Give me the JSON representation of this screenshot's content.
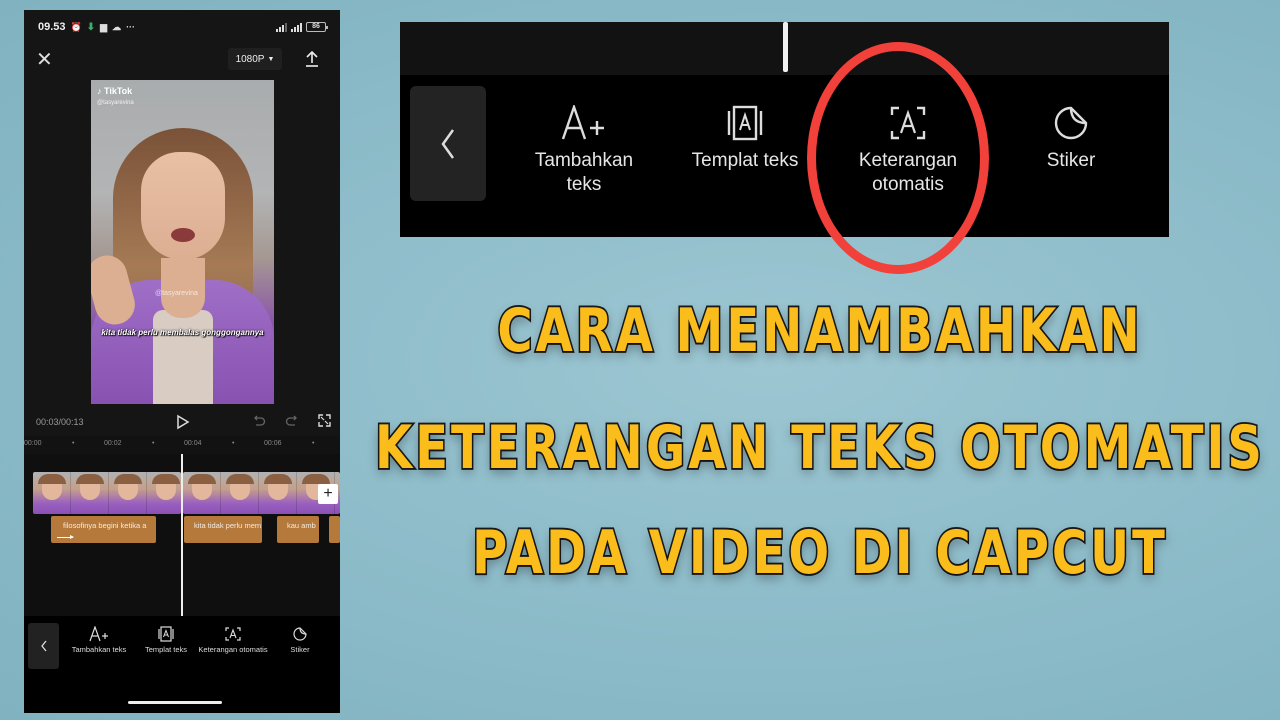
{
  "status_bar": {
    "time": "09.53",
    "battery": "86",
    "more": "···"
  },
  "top_bar": {
    "resolution": "1080P",
    "close_icon": "close-icon",
    "export_icon": "upload-icon"
  },
  "preview": {
    "watermark_brand": "TikTok",
    "watermark_handle": "@tasyarevina",
    "center_watermark": "@tasyarevina",
    "caption": "kita tidak perlu membalas gonggongannya"
  },
  "playback": {
    "timecode": "00:03/00:13",
    "ruler": [
      "00:00",
      "00:02",
      "00:04",
      "00:06"
    ]
  },
  "timeline": {
    "text_clips": [
      "filosofinya begini ketika a",
      "kita tidak perlu mem",
      "kau amb",
      ""
    ],
    "add_label": "+"
  },
  "toolbar": {
    "items": [
      {
        "label": "Tambahkan teks",
        "icon": "add-text-icon"
      },
      {
        "label": "Templat teks",
        "icon": "text-template-icon"
      },
      {
        "label": "Keterangan otomatis",
        "icon": "auto-caption-icon"
      },
      {
        "label": "Stiker",
        "icon": "sticker-icon"
      }
    ]
  },
  "zoom_toolbar": {
    "items": [
      {
        "label_line1": "Tambahkan",
        "label_line2": "teks"
      },
      {
        "label_line1": "Templat teks",
        "label_line2": ""
      },
      {
        "label_line1": "Keterangan",
        "label_line2": "otomatis"
      },
      {
        "label_line1": "Stiker",
        "label_line2": ""
      }
    ],
    "highlight_color": "#f2403a"
  },
  "title": {
    "line1": "CARA MENAMBAHKAN",
    "line2": "KETERANGAN TEKS OTOMATIS",
    "line3": "PADA VIDEO DI CAPCUT",
    "color": "#fbbd1c"
  }
}
